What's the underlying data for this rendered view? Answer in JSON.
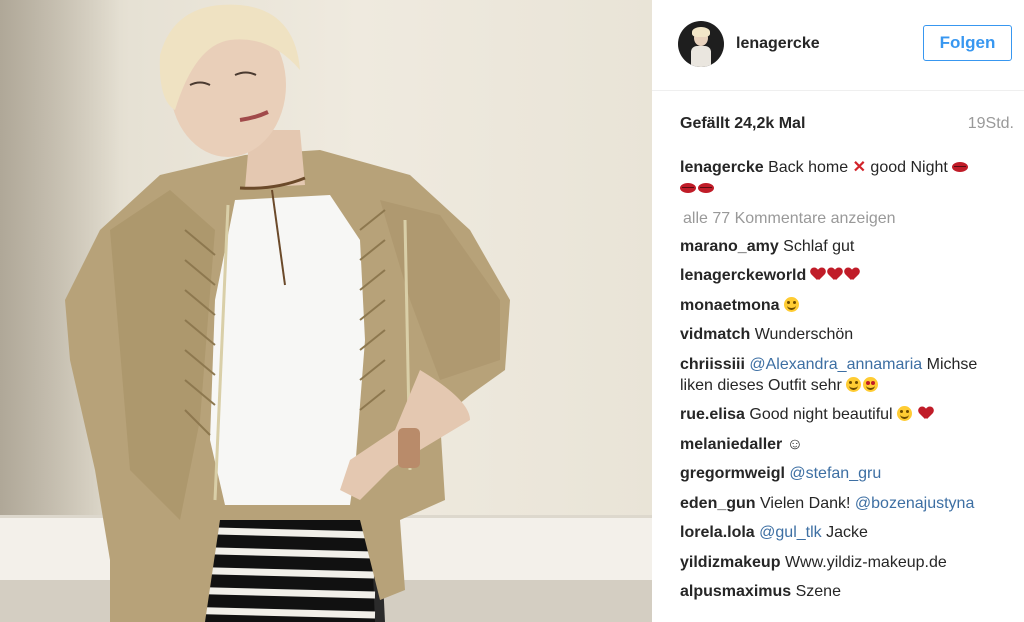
{
  "post": {
    "username": "lenagercke",
    "follow_label": "Folgen",
    "likes": "Gefällt 24,2k Mal",
    "time": "19Std."
  },
  "caption": {
    "user": "lenagercke",
    "text1": "Back home",
    "cross": "✕",
    "text2": "good Night"
  },
  "view_all": "alle 77 Kommentare anzeigen",
  "comments": [
    {
      "user": "marano_amy",
      "text": "Schlaf gut"
    },
    {
      "user": "lenagerckeworld",
      "text": ""
    },
    {
      "user": "monaetmona",
      "text": ""
    },
    {
      "user": "vidmatch",
      "text": "Wunderschön"
    },
    {
      "user": "chriissiii",
      "mention": "@Alexandra_annamaria",
      "text": "Michse liken dieses Outfit sehr"
    },
    {
      "user": "rue.elisa",
      "text": "Good night beautiful"
    },
    {
      "user": "melaniedaller",
      "text": "☺"
    },
    {
      "user": "gregormweigl",
      "mention": "@stefan_gru",
      "text": ""
    },
    {
      "user": "eden_gun",
      "text": "Vielen Dank!",
      "mention": "@bozenajustyna"
    },
    {
      "user": "lorela.lola",
      "mention": "@gul_tlk",
      "text": "Jacke"
    },
    {
      "user": "yildizmakeup",
      "text": "Www.yildiz-makeup.de"
    },
    {
      "user": "alpusmaximus",
      "text": "Szene"
    }
  ],
  "icons": [
    "kiss-mark-icon",
    "cross-mark-icon",
    "red-heart-icon",
    "smiley-icon",
    "heart-eyes-icon",
    "broken-heart-icon"
  ],
  "colors": {
    "link": "#3897f0",
    "mention": "#3d6fa3",
    "muted": "#999999",
    "text": "#262626"
  }
}
